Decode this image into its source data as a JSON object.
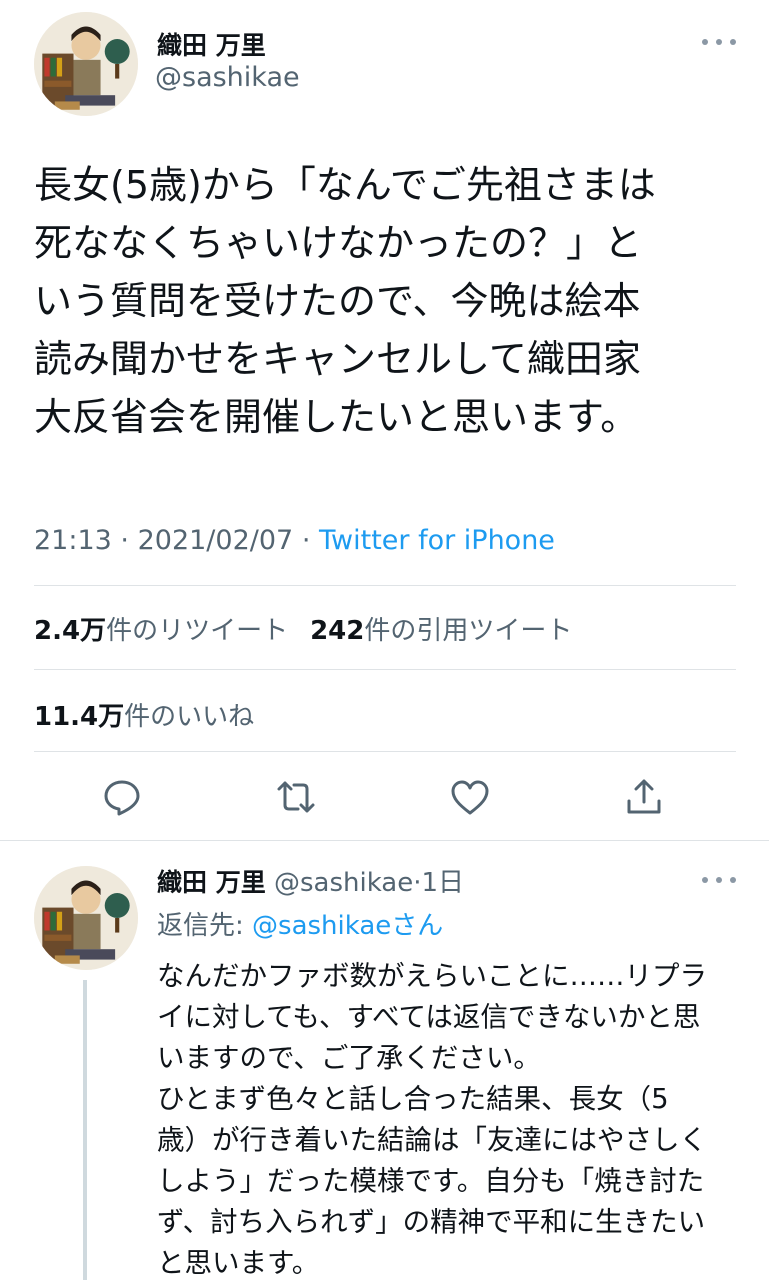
{
  "tweet": {
    "author_name": "織田 万里",
    "author_handle": "@sashikae",
    "text_lines": [
      "長女(5歳)から「なんでご先祖さまは",
      "死ななくちゃいけなかったの？」と",
      "いう質問を受けたので、今晩は絵本",
      "読み聞かせをキャンセルして織田家",
      "大反省会を開催したいと思います。"
    ],
    "time": "21:13",
    "date": "2021/02/07",
    "separator": "·",
    "source": "Twitter for iPhone",
    "retweets": {
      "count": "2.4万",
      "label": "件のリツイート"
    },
    "quotes": {
      "count": "242",
      "label": "件の引用ツイート"
    },
    "likes": {
      "count": "11.4万",
      "label": "件のいいね"
    },
    "actions": [
      "reply-icon",
      "retweet-icon",
      "like-icon",
      "share-icon"
    ]
  },
  "reply": {
    "author_name": "織田 万里",
    "author_handle": "@sashikae",
    "separator": "·",
    "age": "1日",
    "reply_to_label": "返信先: ",
    "reply_to_mention": "@sashikaeさん",
    "text_lines": [
      "なんだかファボ数がえらいことに……リプラ",
      "イに対しても、すべては返信できないかと思",
      "いますので、ご了承ください。",
      "ひとまず色々と話し合った結果、長女（5",
      "歳）が行き着いた結論は「友達にはやさしく",
      "しよう」だった模様です。自分も「焼き討た",
      "ず、討ち入られず」の精神で平和に生きたい",
      "と思います。"
    ]
  },
  "colors": {
    "text": "#0f1419",
    "secondary": "#536471",
    "link": "#1d9bf0",
    "divider": "#dfe3e6"
  }
}
